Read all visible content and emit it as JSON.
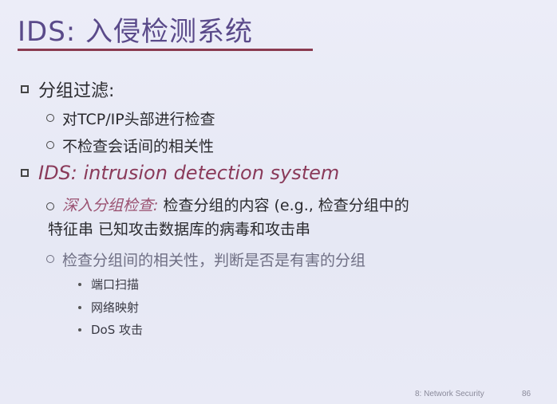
{
  "title": "IDS: 入侵检测系统",
  "bullets": {
    "b1": {
      "label": "分组过滤:",
      "sub": [
        "对TCP/IP头部进行检查",
        "不检查会话间的相关性"
      ]
    },
    "b2": {
      "label": "IDS: intrusion detection system",
      "sub1": {
        "emph": "深入分组检查:",
        "rest": " 检查分组的内容 (e.g., 检查分组中的",
        "line2": "特征串 已知攻击数据库的病毒和攻击串"
      },
      "sub2": "检查分组间的相关性，判断是否是有害的分组",
      "sub2_items": [
        "端口扫描",
        "网络映射",
        "DoS 攻击"
      ]
    }
  },
  "footer": {
    "section": "8: Network Security",
    "page": "86"
  }
}
